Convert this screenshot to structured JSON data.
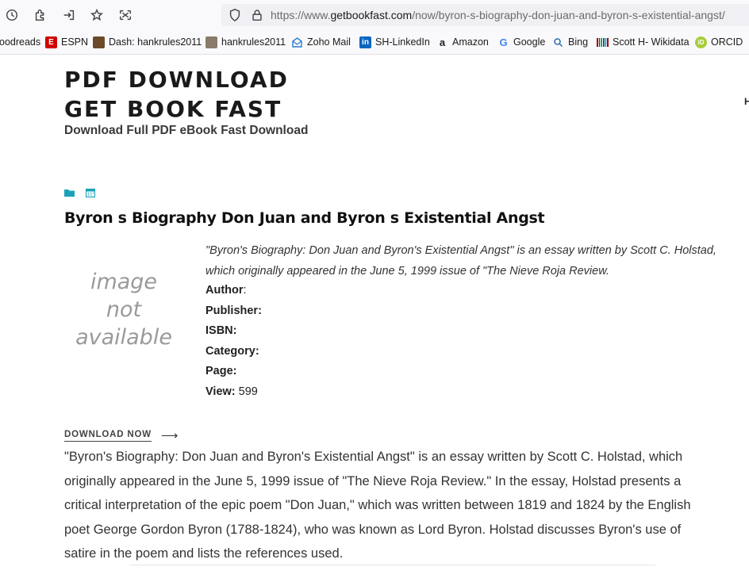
{
  "browser": {
    "url_prefix": "https://www.",
    "url_host": "getbookfast.com",
    "url_path": "/now/byron-s-biography-don-juan-and-byron-s-existential-angst/",
    "bookmarks": [
      {
        "label": "oodreads",
        "icon": "goodreads-icon",
        "color": "#553b08"
      },
      {
        "label": "ESPN",
        "icon": "espn-icon",
        "color": "#d00000"
      },
      {
        "label": "Dash: hankrules2011",
        "icon": "dash-avatar-icon",
        "color": "#6b4a2a"
      },
      {
        "label": "hankrules2011",
        "icon": "profile-avatar-icon",
        "color": "#8a7a6a"
      },
      {
        "label": "Zoho Mail",
        "icon": "zoho-mail-icon",
        "color": "#2a7fd4"
      },
      {
        "label": "SH-LinkedIn",
        "icon": "linkedin-icon",
        "color": "#0a66c2"
      },
      {
        "label": "Amazon",
        "icon": "amazon-icon",
        "color": "#222222"
      },
      {
        "label": "Google",
        "icon": "google-icon",
        "color": "#4285f4"
      },
      {
        "label": "Bing",
        "icon": "bing-search-icon",
        "color": "#2b6cb0"
      },
      {
        "label": "Scott H- Wikidata",
        "icon": "wikidata-icon",
        "color": "#990000"
      },
      {
        "label": "ORCID",
        "icon": "orcid-icon",
        "color": "#a6ce39"
      }
    ]
  },
  "site": {
    "title": "PDF DOWNLOAD GET BOOK FAST",
    "description": "Download Full PDF eBook Fast Download",
    "edge_letter": "H"
  },
  "post": {
    "title": "Byron s Biography Don Juan and Byron s Existential Angst",
    "cover_text_line1": "image",
    "cover_text_line2": "not",
    "cover_text_line3": "available",
    "excerpt": "\"Byron's Biography: Don Juan and Byron's Existential Angst\" is an essay written by Scott C. Holstad, which originally appeared in the June 5, 1999 issue of \"The Nieve Roja Review.",
    "fields": [
      {
        "key": "Author",
        "sep": ":",
        "value": ""
      },
      {
        "key": "Publisher:",
        "sep": "",
        "value": ""
      },
      {
        "key": "ISBN:",
        "sep": "",
        "value": ""
      },
      {
        "key": "Category:",
        "sep": "",
        "value": ""
      },
      {
        "key": "Page:",
        "sep": "",
        "value": ""
      },
      {
        "key": "View:",
        "sep": "",
        "value": " 599"
      }
    ],
    "download_label": "DOWNLOAD NOW",
    "download_arrow": "⟶",
    "body": "\"Byron's Biography: Don Juan and Byron's Existential Angst\" is an essay written by Scott C. Holstad, which originally appeared in the June 5, 1999 issue of \"The Nieve Roja Review.\" In the essay, Holstad presents a critical interpretation of the epic poem \"Don Juan,\" which was written between 1819 and 1824 by the English poet George Gordon Byron (1788-1824), who was known as Lord Byron. Holstad discusses Byron's use of satire in the poem and lists the references used."
  },
  "colors": {
    "accent": "#1aa3b8"
  }
}
